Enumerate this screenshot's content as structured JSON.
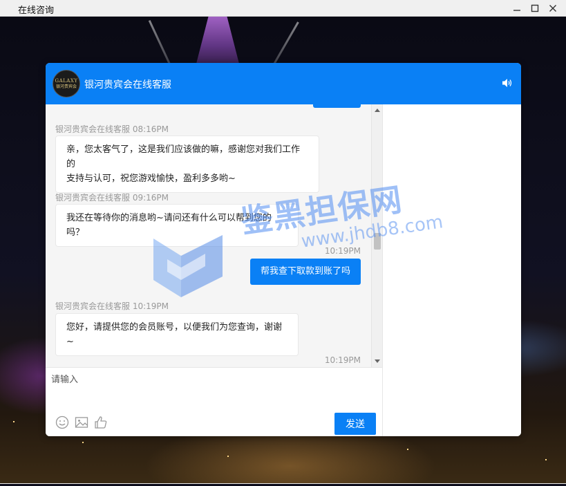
{
  "window": {
    "title": "在线咨询"
  },
  "chat": {
    "header_title": "银河贵宾会在线客服",
    "avatar": {
      "brand": "GALAXY",
      "sub": "银河贵宾会"
    },
    "messages": [
      {
        "side": "left",
        "meta": "银河贵宾会在线客服 08:16PM",
        "lines": [
          "亲，您太客气了，这是我们应该做的嘛，感谢您对我们工作的",
          "支持与认可，祝您游戏愉快，盈利多多哟~"
        ]
      },
      {
        "side": "left",
        "meta": "银河贵宾会在线客服 09:16PM",
        "lines": [
          "我还在等待你的消息哟~请问还有什么可以帮到您的吗？"
        ]
      },
      {
        "side": "right",
        "time": "10:19PM",
        "text": "帮我查下取款到账了吗"
      },
      {
        "side": "left",
        "meta": "银河贵宾会在线客服 10:19PM",
        "lines": [
          "您好，请提供您的会员账号，以便我们为您查询，谢谢~"
        ]
      },
      {
        "side": "right",
        "time": "10:19PM"
      }
    ],
    "input": {
      "placeholder": "请输入",
      "value": ""
    },
    "send_label": "发送"
  },
  "watermark": {
    "text": "鉴黑担保网",
    "url": "www.jhdb8.com"
  },
  "colors": {
    "accent": "#0a80f5",
    "bubble_bg": "#ffffff",
    "messages_bg": "#f5f5f5"
  },
  "icons": [
    "minimize-icon",
    "maximize-icon",
    "close-icon",
    "speaker-icon",
    "emoji-icon",
    "image-icon",
    "thumbs-up-icon"
  ]
}
